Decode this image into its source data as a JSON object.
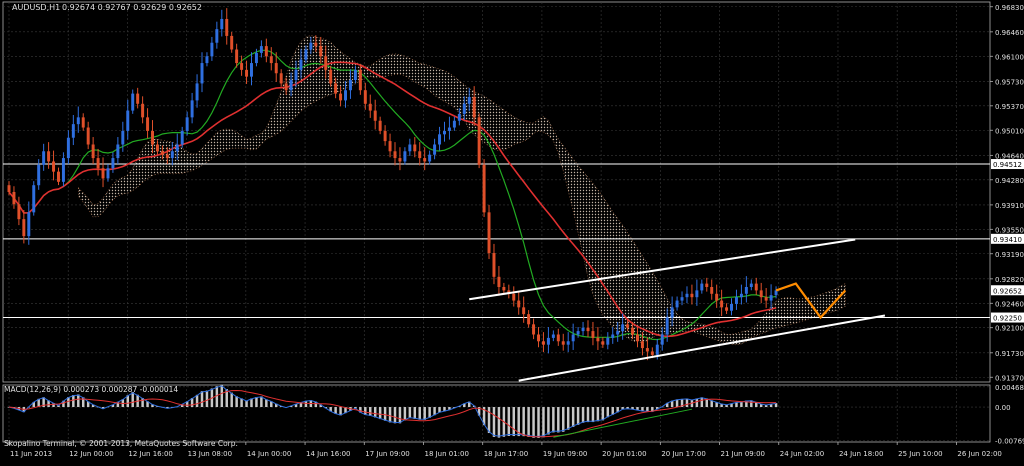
{
  "colors": {
    "background": "#000000",
    "grid": "#3a3a3a",
    "axis": "#b0b0b0",
    "text": "#e0e0e0",
    "bull": "#2f6fe0",
    "bear": "#e0502a",
    "ma_fast": "#22aa22",
    "ma_slow": "#e03030",
    "cloud": "#d8c8b8",
    "cloud_b": "#c8845a",
    "channel": "#ffffff",
    "level": "#ffffff",
    "forecast": "#ff8c00",
    "macd_hist": "#c8c8c8",
    "macd_signal": "#e03030",
    "macd_line": "#2f6fe0",
    "divergence": "#22aa22",
    "price_box_bg": "#ffffff",
    "price_box_text": "#000000"
  },
  "header": {
    "symbol": "AUDUSD,H1",
    "ohlc": "0.92674 0.92767 0.92629 0.92652"
  },
  "macd": {
    "label": "MACD(12,26,9) 0.000273 0.000287 -0.000014"
  },
  "footer": {
    "copyright": "Skopalino Terminal, © 2001-2013, MetaQuotes Software Corp."
  },
  "chart_data": [
    {
      "type": "candlestick",
      "title": "AUDUSD,H1",
      "x_labels": [
        "11 Jun 2013",
        "12 Jun 00:00",
        "12 Jun 16:00",
        "13 Jun 08:00",
        "14 Jun 00:00",
        "14 Jun 16:00",
        "17 Jun 09:00",
        "18 Jun 01:00",
        "18 Jun 17:00",
        "19 Jun 09:00",
        "20 Jun 01:00",
        "20 Jun 17:00",
        "21 Jun 09:00",
        "24 Jun 02:00",
        "24 Jun 18:00",
        "25 Jun 10:00",
        "26 Jun 02:00"
      ],
      "y_ticks": [
        0.9683,
        0.9646,
        0.961,
        0.9573,
        0.9537,
        0.9501,
        0.9464,
        0.9428,
        0.9391,
        0.9355,
        0.9319,
        0.9282,
        0.9246,
        0.921,
        0.9173,
        0.9137
      ],
      "ylim": [
        0.913,
        0.969
      ],
      "grid": true,
      "price_labels": [
        {
          "value": 0.94512,
          "text": "0.94512"
        },
        {
          "value": 0.9341,
          "text": "0.93410"
        },
        {
          "value": 0.92652,
          "text": "0.92652"
        },
        {
          "value": 0.9225,
          "text": "0.92250"
        }
      ],
      "horizontal_levels": [
        0.94512,
        0.9341,
        0.9225
      ],
      "closes": [
        0.941,
        0.9392,
        0.937,
        0.9345,
        0.938,
        0.942,
        0.945,
        0.947,
        0.9455,
        0.944,
        0.9425,
        0.946,
        0.949,
        0.951,
        0.952,
        0.9505,
        0.948,
        0.946,
        0.9445,
        0.943,
        0.9445,
        0.946,
        0.948,
        0.95,
        0.953,
        0.9555,
        0.954,
        0.952,
        0.95,
        0.948,
        0.947,
        0.9465,
        0.946,
        0.947,
        0.948,
        0.95,
        0.952,
        0.9545,
        0.957,
        0.96,
        0.961,
        0.963,
        0.965,
        0.9665,
        0.964,
        0.962,
        0.96,
        0.959,
        0.958,
        0.96,
        0.9615,
        0.9625,
        0.961,
        0.96,
        0.9585,
        0.957,
        0.956,
        0.9575,
        0.959,
        0.9605,
        0.962,
        0.963,
        0.9625,
        0.961,
        0.959,
        0.957,
        0.9555,
        0.9545,
        0.956,
        0.9575,
        0.959,
        0.956,
        0.954,
        0.953,
        0.9515,
        0.95,
        0.9485,
        0.947,
        0.946,
        0.9455,
        0.947,
        0.948,
        0.947,
        0.946,
        0.9455,
        0.9465,
        0.948,
        0.9495,
        0.95,
        0.9505,
        0.9515,
        0.9525,
        0.954,
        0.955,
        0.952,
        0.945,
        0.938,
        0.932,
        0.9285,
        0.927,
        0.9265,
        0.926,
        0.925,
        0.924,
        0.923,
        0.9215,
        0.92,
        0.919,
        0.9185,
        0.9195,
        0.92,
        0.919,
        0.9185,
        0.919,
        0.92,
        0.9205,
        0.921,
        0.9205,
        0.9195,
        0.919,
        0.9185,
        0.9195,
        0.92,
        0.9205,
        0.9215,
        0.921,
        0.92,
        0.919,
        0.918,
        0.9175,
        0.917,
        0.9185,
        0.92,
        0.9225,
        0.924,
        0.925,
        0.9255,
        0.926,
        0.9255,
        0.9265,
        0.9275,
        0.927,
        0.926,
        0.925,
        0.924,
        0.9235,
        0.9245,
        0.9255,
        0.926,
        0.927,
        0.9275,
        0.9265,
        0.9255,
        0.925,
        0.9258,
        0.9265
      ],
      "overlays": [
        "fast moving average (green)",
        "slow moving average (red)",
        "Ichimoku-style cloud",
        "ascending channel (white)",
        "forecast path (orange)"
      ],
      "forecast": [
        0.9275,
        0.9225,
        0.9265
      ]
    },
    {
      "type": "bar",
      "title": "MACD(12,26,9) 0.000273 0.000287 -0.000014",
      "y_ticks": [
        0.004687,
        0.0,
        -0.007696
      ],
      "ylim": [
        -0.0081,
        0.0051
      ],
      "grid": true
    }
  ]
}
